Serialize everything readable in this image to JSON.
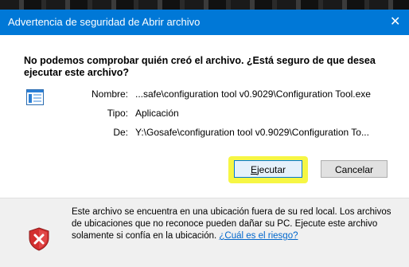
{
  "dialog": {
    "title": "Advertencia de seguridad de Abrir archivo",
    "close_symbol": "✕",
    "question": "No podemos comprobar quién creó el archivo. ¿Está seguro de que desea ejecutar este archivo?",
    "file_icon": "application-window-icon",
    "details": {
      "name_label": "Nombre:",
      "name_value": "...safe\\configuration tool v0.9029\\Configuration Tool.exe",
      "type_label": "Tipo:",
      "type_value": "Aplicación",
      "from_label": "De:",
      "from_value": "Y:\\Gosafe\\configuration tool v0.9029\\Configuration To..."
    },
    "buttons": {
      "run_label_underlined": "E",
      "run_label_rest": "jecutar",
      "cancel_label": "Cancelar"
    },
    "footer": {
      "warning_icon": "shield-warning-icon",
      "text": "Este archivo se encuentra en una ubicación fuera de su red local. Los archivos de ubicaciones que no reconoce pueden dañar su PC. Ejecute este archivo solamente si confía en la ubicación.",
      "link": "¿Cuál es el riesgo?"
    }
  },
  "colors": {
    "titlebar": "#0078d7",
    "highlight": "#f6f63a",
    "link": "#0066cc"
  }
}
